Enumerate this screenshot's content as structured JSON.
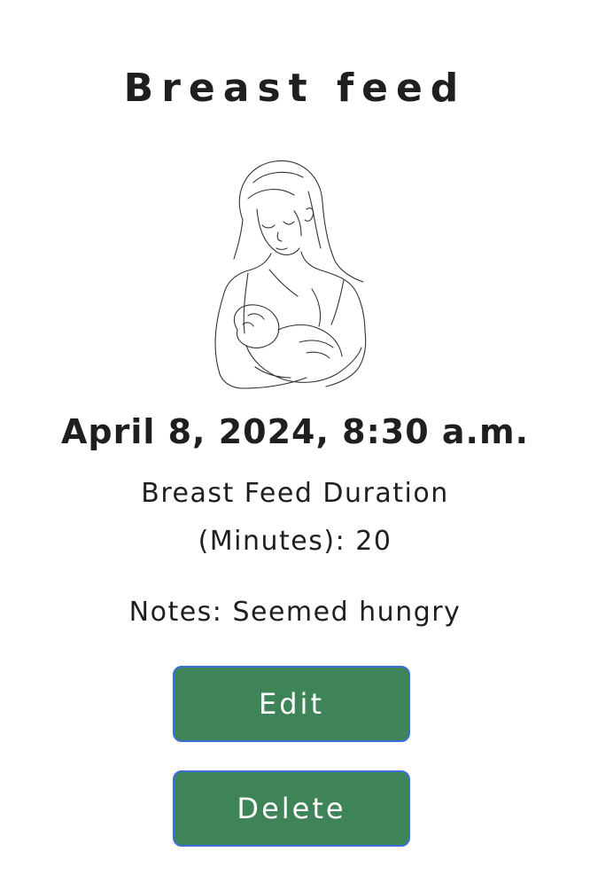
{
  "page": {
    "title": "Breast feed"
  },
  "entry": {
    "datetime": "April 8, 2024, 8:30 a.m.",
    "duration_text": "Breast Feed Duration (Minutes): 20",
    "notes_text": "Notes: Seemed hungry"
  },
  "illustration": {
    "icon": "mother-breastfeeding-sketch"
  },
  "actions": {
    "edit_label": "Edit",
    "delete_label": "Delete"
  },
  "colors": {
    "button_bg": "#3f8458",
    "button_border": "#3a6fd8",
    "text": "#1f1f1f"
  }
}
